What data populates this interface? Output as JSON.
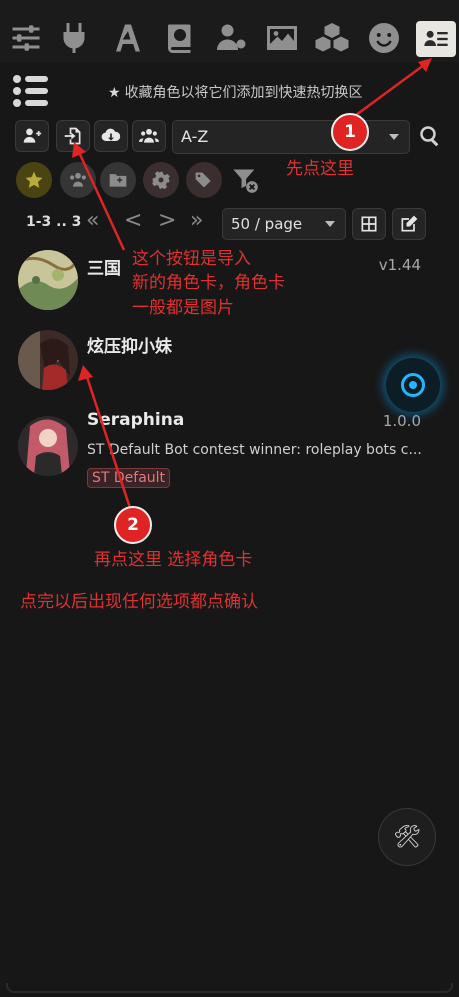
{
  "toolbar": {
    "icons": [
      "sliders-icon",
      "plug-icon",
      "font-icon",
      "book-globe-icon",
      "user-cog-icon",
      "image-icon",
      "cubes-icon",
      "smile-icon",
      "character-card-icon"
    ]
  },
  "favorites_hint": "收藏角色以将它们添加到快速热切换区",
  "actions": {
    "sort_value": "A-Z"
  },
  "pager": {
    "count": "1-3 .. 3",
    "per_page": "50 / page",
    "first": "«",
    "prev": "<",
    "next": ">",
    "last": "»"
  },
  "characters": [
    {
      "name": "三国",
      "version": "v1.44",
      "description": "",
      "tag": ""
    },
    {
      "name": "炫压抑小妹",
      "version": "",
      "description": "",
      "tag": ""
    },
    {
      "name": "Seraphina",
      "version": "1.0.0",
      "description": "ST Default Bot contest winner: roleplay bots c...",
      "tag": "ST Default"
    }
  ],
  "annotations": {
    "step1_badge": "1",
    "step1_text": "先点这里",
    "import_note_line1": "这个按钮是导入",
    "import_note_line2": "新的角色卡，角色卡",
    "import_note_line3": "一般都是图片",
    "step2_badge": "2",
    "step2_text": "再点这里 选择角色卡",
    "confirm_text": "点完以后出现任何选项都点确认"
  },
  "colors": {
    "background": "#171717",
    "annotation_red": "#e03030",
    "glow_blue": "#22b6ff"
  }
}
